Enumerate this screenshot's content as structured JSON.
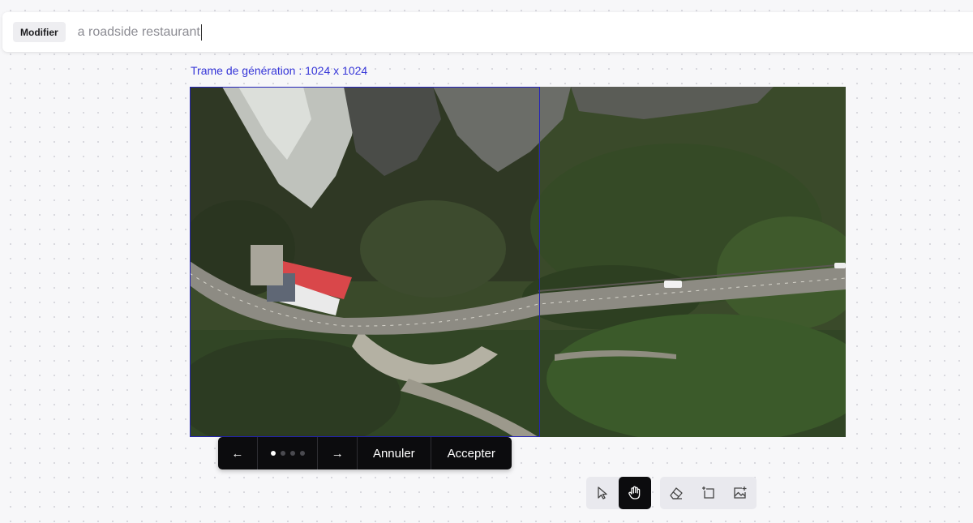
{
  "prompt": {
    "mode_label": "Modifier",
    "text": "a roadside restaurant"
  },
  "frame_label": "Trame de génération : 1024 x 1024",
  "variant_nav": {
    "prev_symbol": "←",
    "next_symbol": "→",
    "variant_count": 4,
    "current_variant": 1,
    "cancel_label": "Annuler",
    "accept_label": "Accepter"
  },
  "tools": [
    {
      "name": "select-arrow-icon",
      "active": false
    },
    {
      "name": "hand-pan-icon",
      "active": true
    },
    {
      "name": "eraser-icon",
      "active": false
    },
    {
      "name": "expand-frame-icon",
      "active": false
    },
    {
      "name": "add-image-icon",
      "active": false
    }
  ],
  "colors": {
    "accent": "#3535d8",
    "frame_border": "#2323b8",
    "toolbar_dark": "#0c0c0e"
  }
}
